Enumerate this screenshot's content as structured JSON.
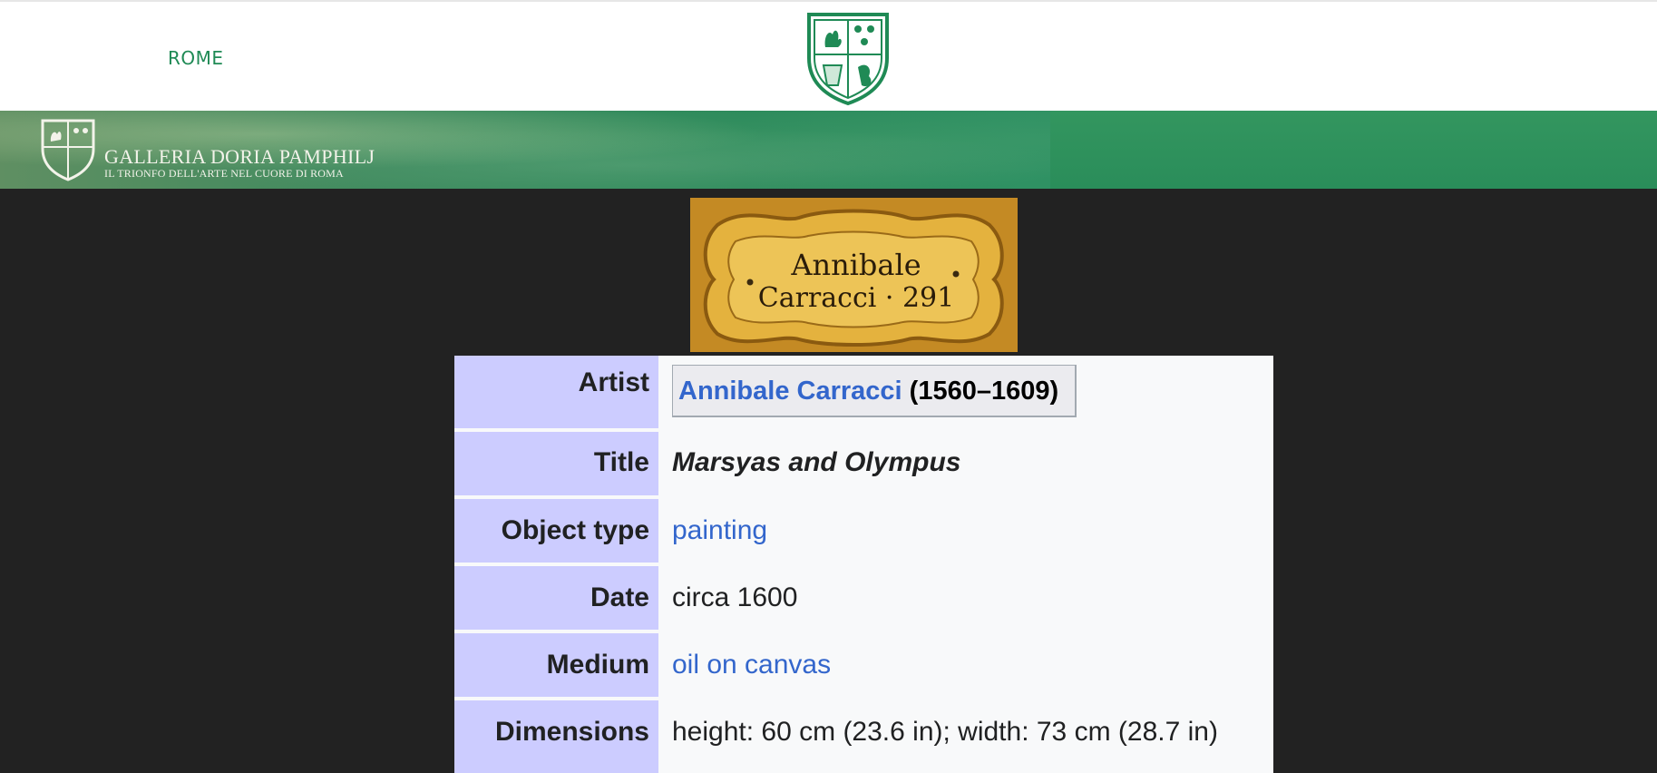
{
  "nav": {
    "rome_label": "ROME"
  },
  "banner": {
    "gallery_name": "GALLERIA DORIA PAMPHILJ",
    "tagline": "IL TRIONFO DELL'ARTE NEL CUORE DI ROMA"
  },
  "plaque": {
    "line1": "Annibale",
    "line2": "Carracci · 291"
  },
  "infobox": {
    "artist": {
      "label": "Artist",
      "name": "Annibale Carracci",
      "years": "(1560–1609)"
    },
    "title": {
      "label": "Title",
      "value": "Marsyas and Olympus"
    },
    "object_type": {
      "label": "Object type",
      "value": "painting"
    },
    "date": {
      "label": "Date",
      "value": "circa 1600"
    },
    "medium": {
      "label": "Medium",
      "value": "oil on canvas"
    },
    "dimensions": {
      "label": "Dimensions",
      "value": "height: 60 cm (23.6 in); width: 73 cm (28.7 in)"
    }
  },
  "colors": {
    "label_bg": "#ccccff",
    "link": "#3366cc",
    "brand_green": "#1f8a55",
    "page_bg": "#222222"
  }
}
